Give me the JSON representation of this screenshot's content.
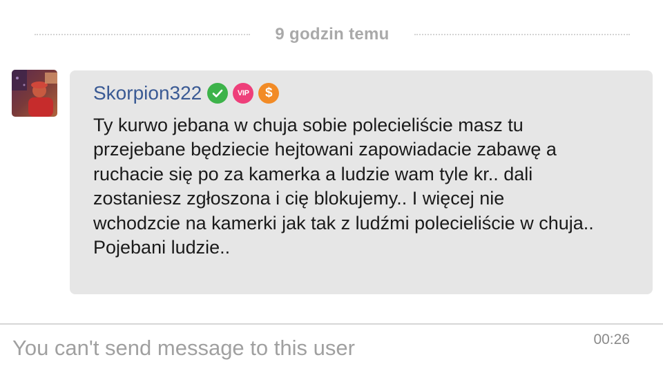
{
  "divider": {
    "time_ago": "9 godzin temu"
  },
  "message": {
    "sender": "Skorpion322",
    "badges": {
      "verified_icon": "check-circle-icon",
      "vip_label": "VIP",
      "coin_symbol": "$"
    },
    "text": "Ty kurwo jebana w chuja sobie polecieliście masz tu\nprzejebane będziecie hejtowani zapowiadacie zabawę a\nruchacie się po za kamerka a ludzie wam tyle kr.. dali\nzostaniesz zgłoszona i cię blokujemy.. I więcej nie\nwchodzcie na kamerki jak tak z ludźmi polecieliście w chuja..\nPojebani ludzie..",
    "time": "00:26"
  },
  "input": {
    "placeholder": "You can't send message to this user"
  },
  "colors": {
    "bubble": "#e6e6e6",
    "sender_name": "#3a5a94",
    "verified_badge": "#3db34a",
    "vip_badge": "#ee3f7a",
    "coin_badge": "#f28b26"
  }
}
